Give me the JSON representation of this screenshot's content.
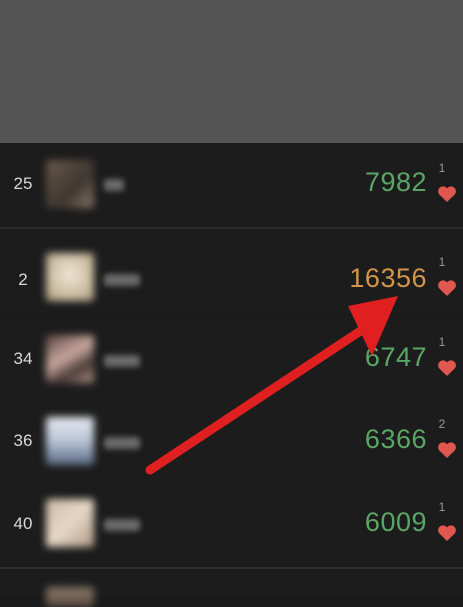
{
  "colors": {
    "score_normal": "#5aa664",
    "score_highlight": "#d4944a",
    "heart": "#e0574f",
    "arrow": "#e02020"
  },
  "icons": {
    "like": "heart-icon",
    "annotation": "arrow-icon"
  },
  "rows": [
    {
      "rank": "25",
      "score": "7982",
      "likes": "1",
      "highlighted": false
    },
    {
      "rank": "2",
      "score": "16356",
      "likes": "1",
      "highlighted": true
    },
    {
      "rank": "34",
      "score": "6747",
      "likes": "1",
      "highlighted": false
    },
    {
      "rank": "36",
      "score": "6366",
      "likes": "2",
      "highlighted": false
    },
    {
      "rank": "40",
      "score": "6009",
      "likes": "1",
      "highlighted": false
    }
  ]
}
